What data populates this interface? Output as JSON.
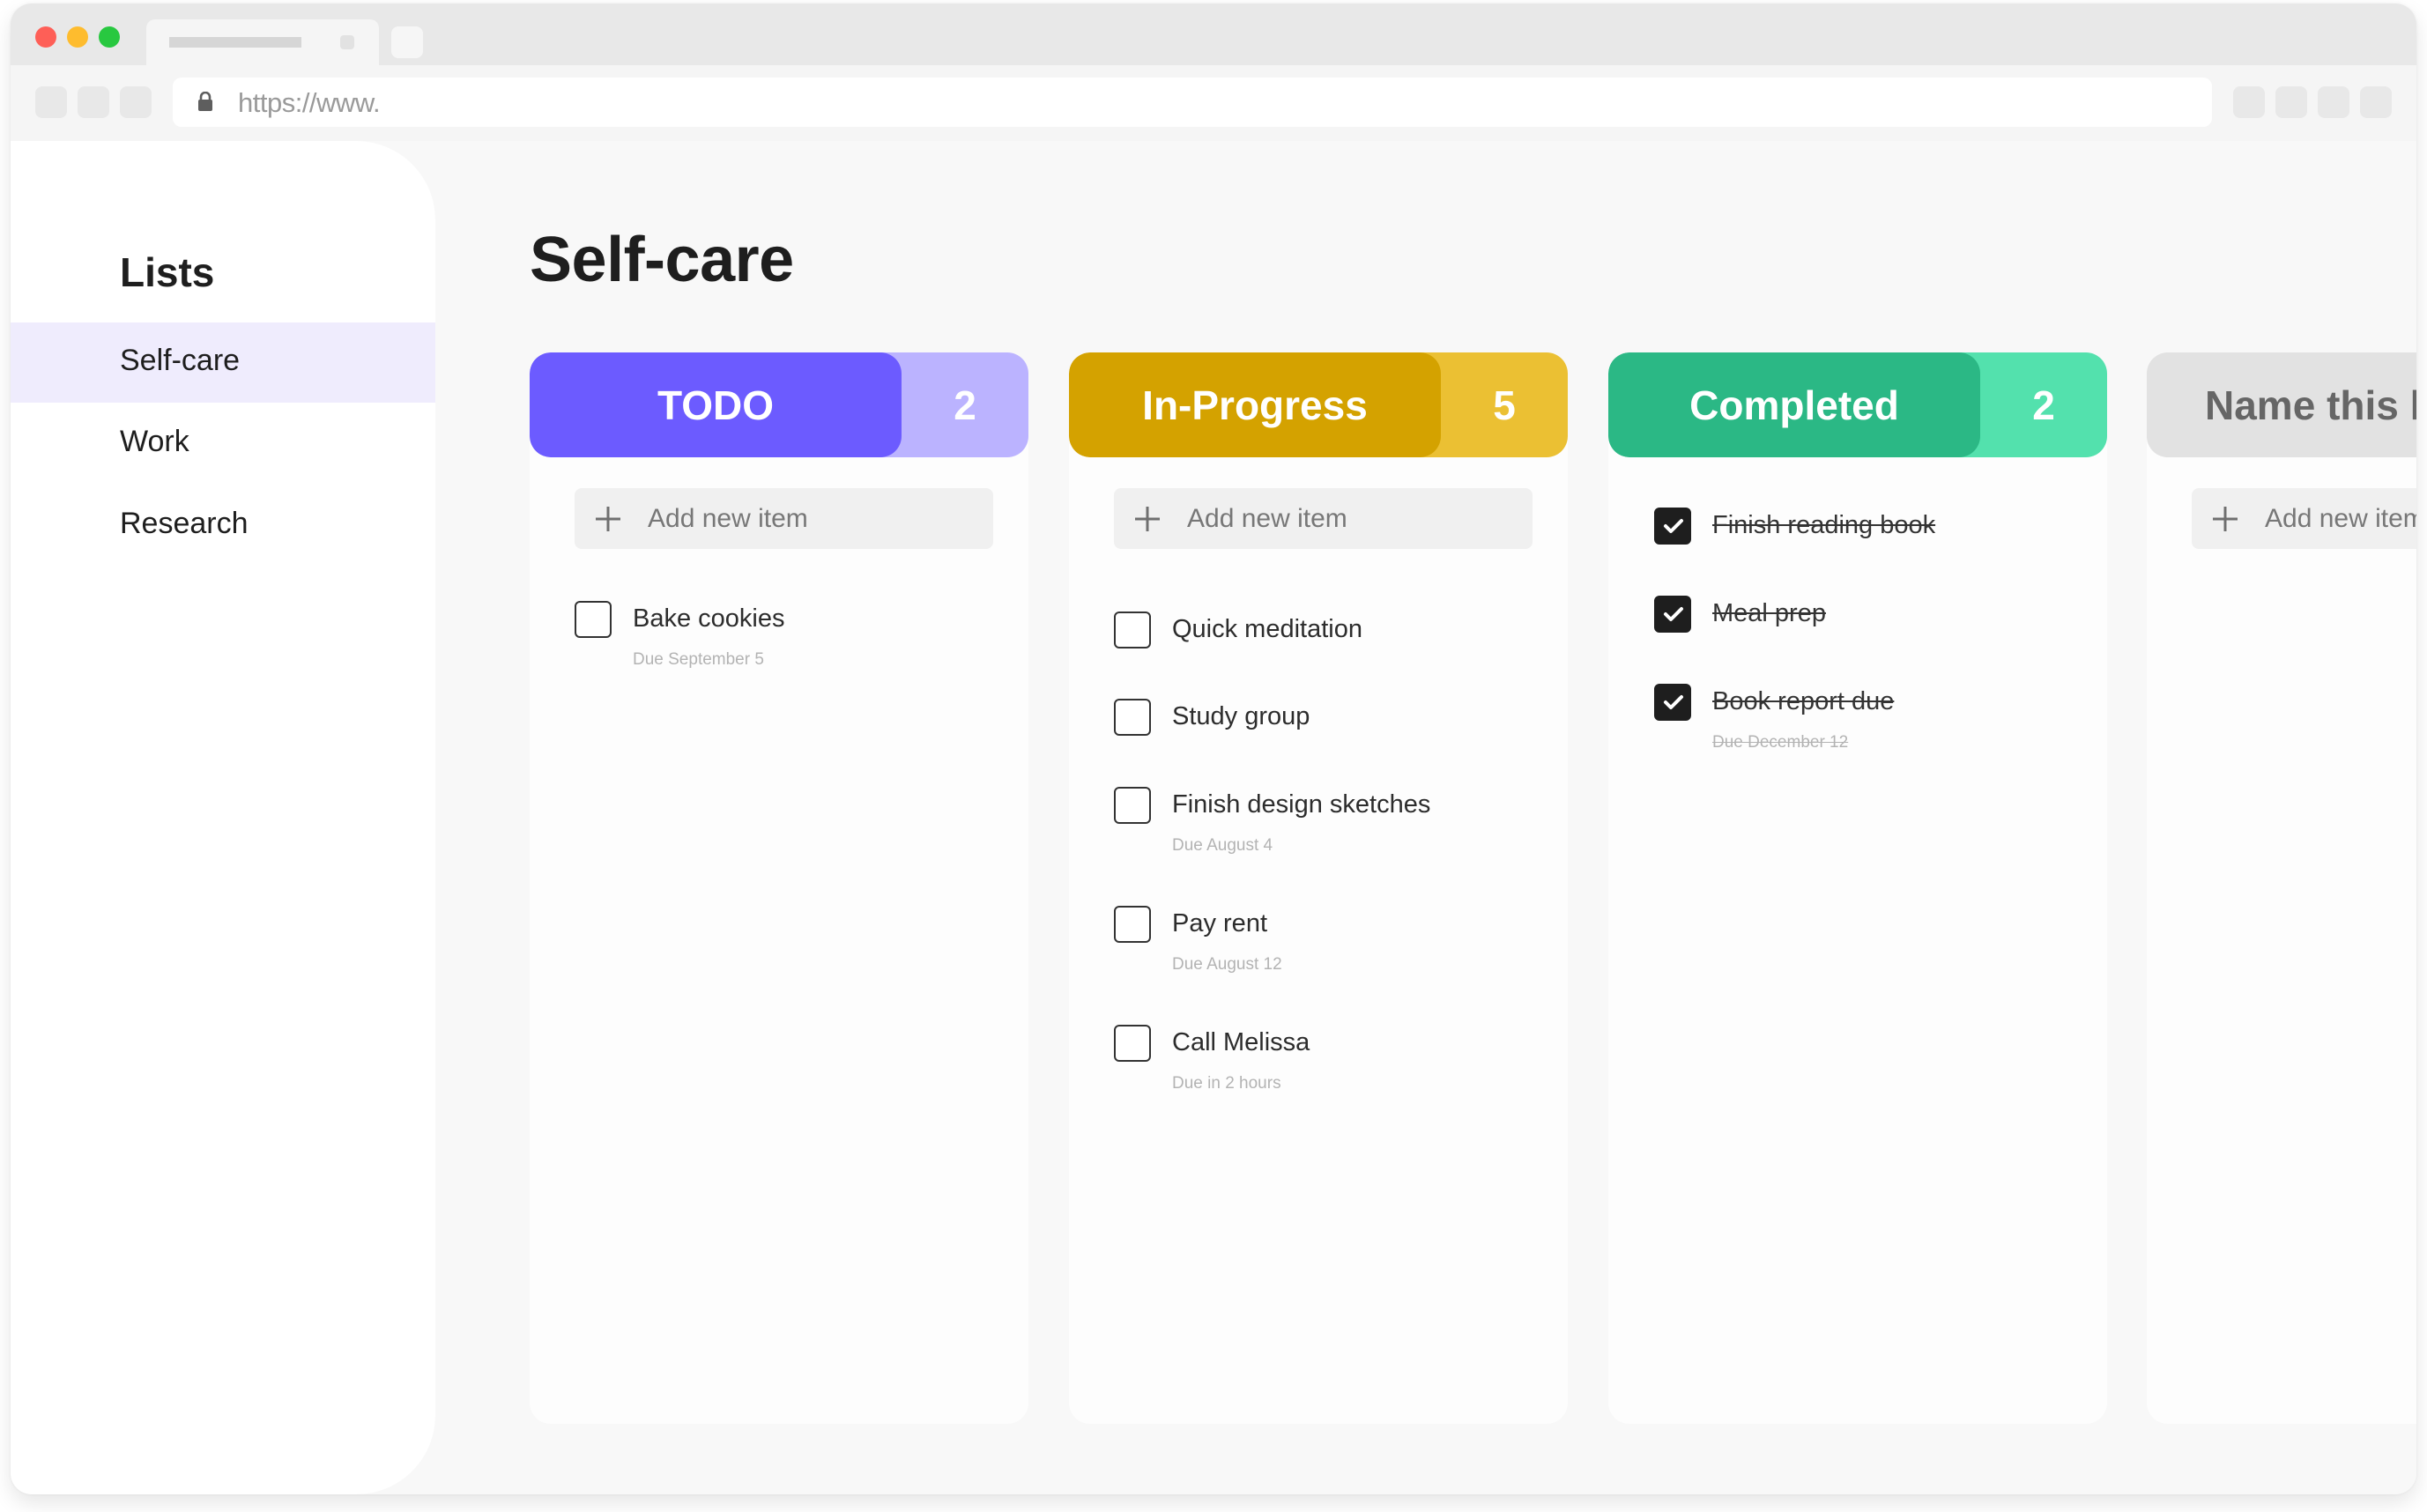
{
  "browser": {
    "url": "https://www."
  },
  "sidebar": {
    "title": "Lists",
    "items": [
      {
        "label": "Self-care",
        "active": true
      },
      {
        "label": "Work",
        "active": false
      },
      {
        "label": "Research",
        "active": false
      }
    ]
  },
  "page": {
    "title": "Self-care"
  },
  "columns": [
    {
      "title": "TODO",
      "count": "2",
      "color_main": "#6c5bff",
      "color_count": "#bbb3ff",
      "add_item_label": "Add new item",
      "tasks": [
        {
          "title": "Bake cookies",
          "due": "Due September 5",
          "done": false
        }
      ]
    },
    {
      "title": "In-Progress",
      "count": "5",
      "color_main": "#d4a200",
      "color_count": "#ebc033",
      "add_item_label": "Add new item",
      "tasks": [
        {
          "title": "Quick meditation",
          "due": "",
          "done": false
        },
        {
          "title": "Study group",
          "due": "",
          "done": false
        },
        {
          "title": "Finish design sketches",
          "due": "Due August 4",
          "done": false
        },
        {
          "title": "Pay rent",
          "due": "Due August 12",
          "done": false
        },
        {
          "title": "Call Melissa",
          "due": "Due in 2 hours",
          "done": false
        }
      ]
    },
    {
      "title": "Completed",
      "count": "2",
      "color_main": "#2bb885",
      "color_count": "#53e1ad",
      "tasks": [
        {
          "title": "Finish reading book",
          "due": "",
          "done": true
        },
        {
          "title": "Meal prep",
          "due": "",
          "done": true
        },
        {
          "title": "Book report due",
          "due": "Due December 12",
          "done": true
        }
      ]
    },
    {
      "title": "Name this list",
      "color_main": "#e2e2e2",
      "add_item_label": "Add new item",
      "tasks": []
    }
  ]
}
